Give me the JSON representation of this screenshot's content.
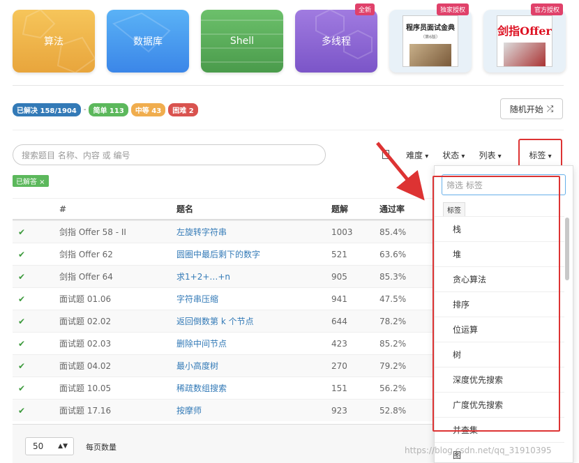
{
  "cards": [
    {
      "label": "算法",
      "badge": ""
    },
    {
      "label": "数据库",
      "badge": ""
    },
    {
      "label": "Shell",
      "badge": ""
    },
    {
      "label": "多线程",
      "badge": "全新"
    },
    {
      "label": "",
      "badge": "独家授权",
      "book_title": "程序员面试金典",
      "book_sub": "（第6版）"
    },
    {
      "label": "",
      "badge": "官方授权",
      "book_title": "剑指Offer"
    }
  ],
  "stats": {
    "solved": "已解决 158/1904",
    "dash": "-",
    "easy": "简单 113",
    "medium": "中等 43",
    "hard": "困难 2"
  },
  "random_button": "随机开始",
  "search_placeholder": "搜索题目 名称、内容 或 编号",
  "filters": {
    "difficulty": "难度",
    "status": "状态",
    "list": "列表",
    "tags": "标签"
  },
  "solved_chip": "已解答 ×",
  "table": {
    "headers": [
      "#",
      "题名",
      "题解",
      "通过率"
    ],
    "rows": [
      {
        "num": "剑指 Offer 58 - II",
        "title": "左旋转字符串",
        "solutions": "1003",
        "rate": "85.4%"
      },
      {
        "num": "剑指 Offer 62",
        "title": "圆圈中最后剩下的数字",
        "solutions": "521",
        "rate": "63.6%"
      },
      {
        "num": "剑指 Offer 64",
        "title": "求1+2+…+n",
        "solutions": "905",
        "rate": "85.3%"
      },
      {
        "num": "面试题 01.06",
        "title": "字符串压缩",
        "solutions": "941",
        "rate": "47.5%"
      },
      {
        "num": "面试题 02.02",
        "title": "返回倒数第 k 个节点",
        "solutions": "644",
        "rate": "78.2%"
      },
      {
        "num": "面试题 02.03",
        "title": "删除中间节点",
        "solutions": "423",
        "rate": "85.2%"
      },
      {
        "num": "面试题 04.02",
        "title": "最小高度树",
        "solutions": "270",
        "rate": "79.2%"
      },
      {
        "num": "面试题 10.05",
        "title": "稀疏数组搜索",
        "solutions": "151",
        "rate": "56.2%"
      },
      {
        "num": "面试题 17.16",
        "title": "按摩师",
        "solutions": "923",
        "rate": "52.8%"
      }
    ]
  },
  "pager": {
    "per_page": "50",
    "per_page_label": "每页数量"
  },
  "tag_dropdown": {
    "search_placeholder": "筛选 标签",
    "group": "标签",
    "items": [
      "栈",
      "堆",
      "贪心算法",
      "排序",
      "位运算",
      "树",
      "深度优先搜索",
      "广度优先搜索",
      "并查集",
      "图"
    ]
  },
  "watermark": "https://blog.csdn.net/qq_31910395",
  "colors": {
    "accent_red": "#d33333",
    "link": "#337ab7",
    "check": "#3c9a3c"
  }
}
